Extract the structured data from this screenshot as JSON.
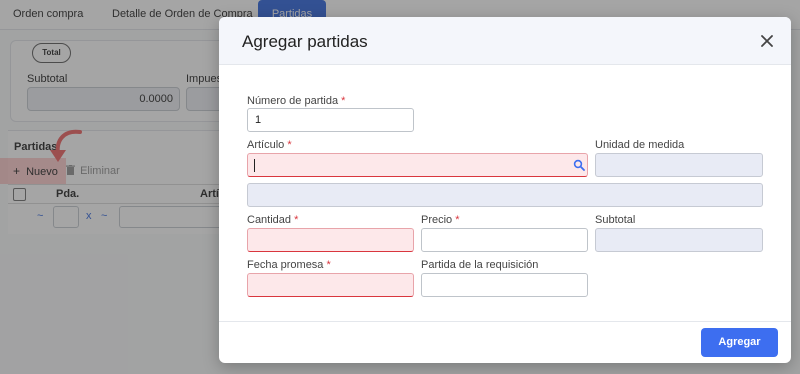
{
  "tabs": [
    {
      "label": "Orden compra"
    },
    {
      "label": "Detalle de Orden de Compra"
    },
    {
      "label": "Partidas"
    }
  ],
  "summary": {
    "pill": "Total",
    "subtotal_label": "Subtotal",
    "subtotal_value": "0.0000",
    "impuestos_label": "Impues"
  },
  "partidas_section": {
    "title": "Partidas",
    "nuevo_label": "Nuevo",
    "eliminar_label": "Eliminar",
    "columns": [
      "Pda.",
      "Artíc"
    ],
    "filter_tilde": "~",
    "filter_x": "x"
  },
  "modal": {
    "title": "Agregar partidas",
    "fields": {
      "numero_partida": {
        "label": "Número de partida",
        "value": "1"
      },
      "articulo": {
        "label": "Artículo",
        "value": ""
      },
      "unidad_medida": {
        "label": "Unidad de medida",
        "value": ""
      },
      "descripcion": {
        "value": ""
      },
      "cantidad": {
        "label": "Cantidad",
        "value": ""
      },
      "precio": {
        "label": "Precio",
        "value": ""
      },
      "subtotal": {
        "label": "Subtotal",
        "value": ""
      },
      "fecha_promesa": {
        "label": "Fecha promesa",
        "value": ""
      },
      "partida_requisicion": {
        "label": "Partida de la requisición",
        "value": ""
      }
    },
    "required_mark": "*",
    "submit_label": "Agregar"
  },
  "colors": {
    "accent": "#3d6ef0",
    "error_bg": "#fde8ea",
    "readonly_bg": "#e8ebf5",
    "required": "#d9363e"
  }
}
